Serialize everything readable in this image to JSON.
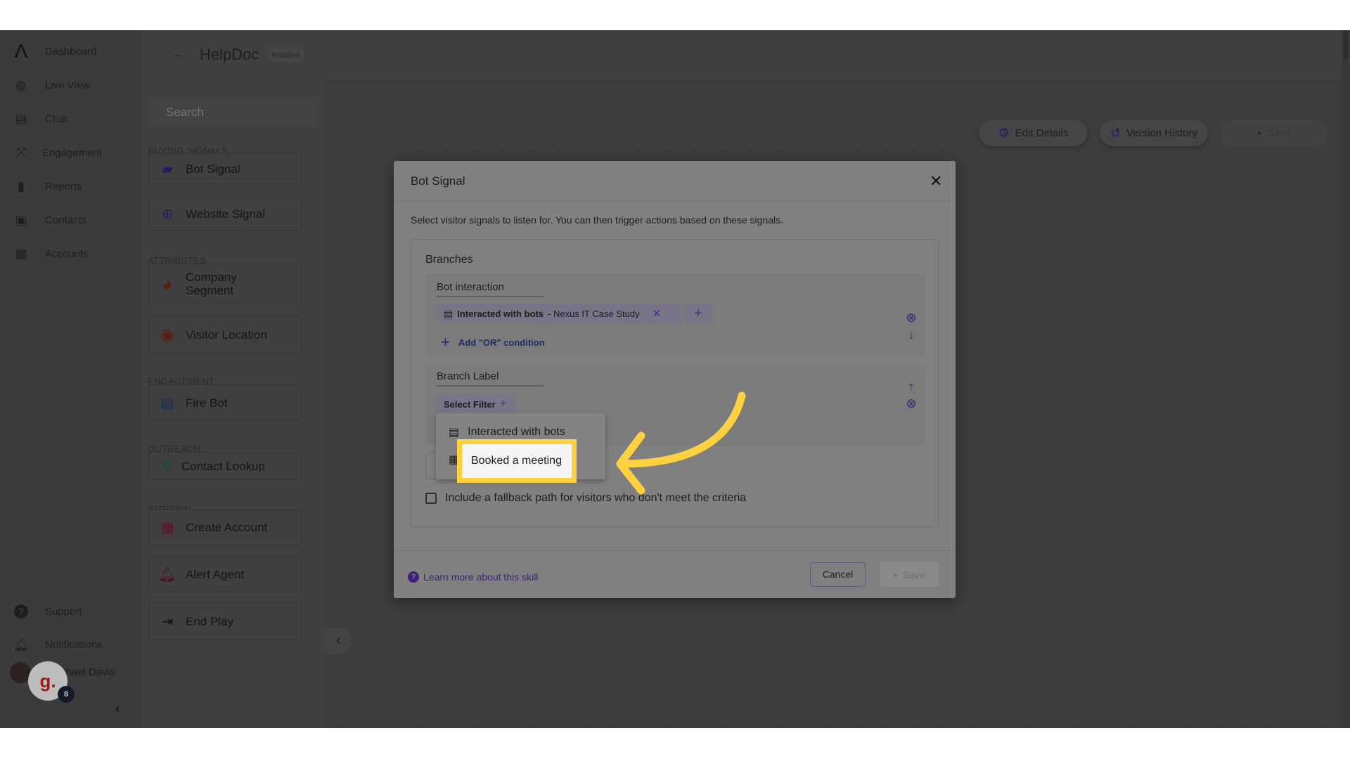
{
  "nav": {
    "items": [
      {
        "label": "Dashboard",
        "icon": "logo-icon"
      },
      {
        "label": "Live View",
        "icon": "globe-search-icon"
      },
      {
        "label": "Chat",
        "icon": "chat-icon"
      },
      {
        "label": "Engagement",
        "icon": "strategy-icon"
      },
      {
        "label": "Reports",
        "icon": "bar-chart-icon"
      },
      {
        "label": "Contacts",
        "icon": "contact-card-icon"
      },
      {
        "label": "Accounts",
        "icon": "building-icon"
      }
    ],
    "bottom": [
      {
        "label": "Support",
        "icon": "help-icon"
      },
      {
        "label": "Notifications",
        "icon": "bell-icon"
      }
    ],
    "user": {
      "name": "Michael Davis",
      "visible_name": "ael Davis"
    },
    "widget": {
      "letter": "g.",
      "badge": "8"
    }
  },
  "header": {
    "title": "HelpDoc",
    "status": "Inactive"
  },
  "panel": {
    "search_placeholder": "Search",
    "sections": [
      {
        "title": "BUYING SIGNALS",
        "items": [
          "Bot Signal",
          "Website Signal"
        ]
      },
      {
        "title": "ATTRIBUTES",
        "items": [
          "Company Segment",
          "Visitor Location"
        ]
      },
      {
        "title": "ENGAGEMENT",
        "items": [
          "Fire Bot"
        ]
      },
      {
        "title": "OUTREACH",
        "items": [
          "Contact Lookup"
        ]
      },
      {
        "title": "INTERNAL",
        "items": [
          "Create Account",
          "Alert Agent",
          "End Play"
        ]
      }
    ]
  },
  "toolbar": {
    "edit_details": "Edit Details",
    "version_history": "Version History",
    "save": "Save"
  },
  "modal": {
    "title": "Bot Signal",
    "description": "Select visitor signals to listen for. You can then trigger actions based on these signals.",
    "branches_title": "Branches",
    "branch1": {
      "label": "Bot interaction",
      "chip_name": "Interacted with bots",
      "chip_value": "- Nexus IT Case Study",
      "add_or": "Add \"OR\" condition"
    },
    "branch2": {
      "label": "Branch Label",
      "select_filter": "Select Filter"
    },
    "dropdown": [
      "Interacted with bots",
      "Booked a meeting"
    ],
    "fallback": "Include a fallback path for visitors who don't meet the criteria",
    "learn_more": "Learn more about this skill",
    "cancel": "Cancel",
    "save": "Save"
  },
  "colors": {
    "accent": "#5b2fb8",
    "highlight": "#ffd140"
  }
}
